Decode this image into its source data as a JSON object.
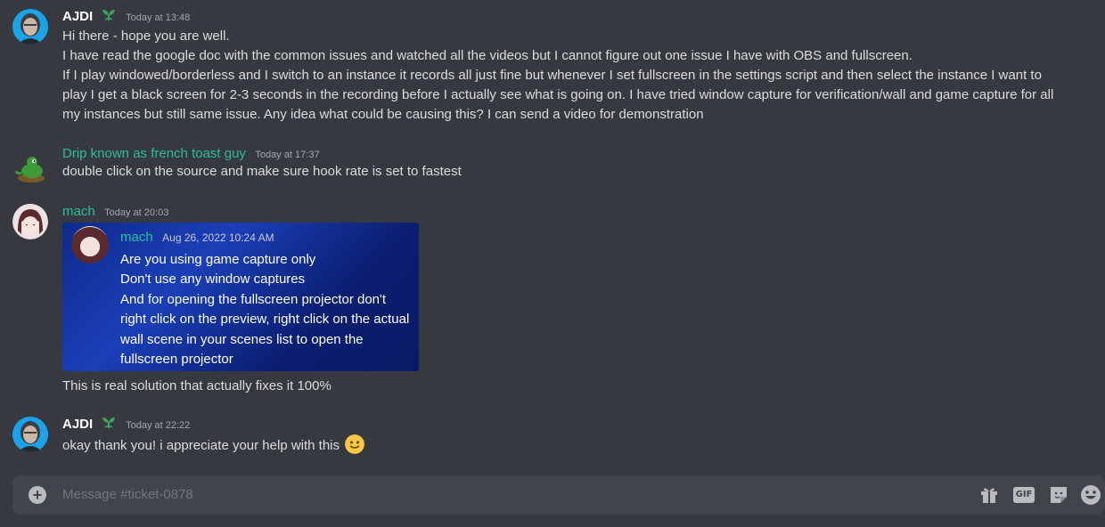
{
  "channel": {
    "placeholder": "Message #ticket-0878"
  },
  "messages": [
    {
      "username": "AJDI",
      "timestamp": "Today at 13:48",
      "lines": [
        "Hi there - hope you are well.",
        "I have read the google doc with the common issues and watched all the videos but I cannot figure out one issue I have with OBS and fullscreen.",
        "If I play windowed/borderless and I switch to an instance it records all just fine but whenever I set fullscreen in the settings script and then select the instance I want to",
        "play I get a black screen for 2-3 seconds in the recording before I actually see what is going on. I have tried window capture for verification/wall and game capture for all",
        "my instances but still same issue. Any idea what could be causing this? I can send a video for demonstration"
      ]
    },
    {
      "username": "Drip known as french toast guy",
      "timestamp": "Today at 17:37",
      "lines": [
        "double click on the source and make sure hook rate is set to fastest"
      ]
    },
    {
      "username": "mach",
      "timestamp": "Today at 20:03",
      "embed": {
        "username": "mach",
        "timestamp": "Aug 26, 2022 10:24 AM",
        "lines": [
          "Are you using game capture only",
          "Don't use any window captures",
          "And for opening the fullscreen projector don't",
          "right click on the preview, right click on the actual",
          "wall scene in your scenes list to open the",
          "fullscreen projector"
        ]
      },
      "lines": [
        "This is real solution that actually fixes it 100%"
      ]
    },
    {
      "username": "AJDI",
      "timestamp": "Today at 22:22",
      "lines": [
        "okay thank you! i appreciate your help with this"
      ],
      "emoji": "slightly-smiling-face"
    }
  ],
  "composer_icons": [
    "gift-icon",
    "gif-icon",
    "sticker-icon",
    "emoji-icon"
  ],
  "icon_labels": {
    "gif": "GIF"
  },
  "colors": {
    "background": "#36393f",
    "composer": "#40444b",
    "username_green": "#2bbf9b",
    "text": "#dcddde"
  }
}
